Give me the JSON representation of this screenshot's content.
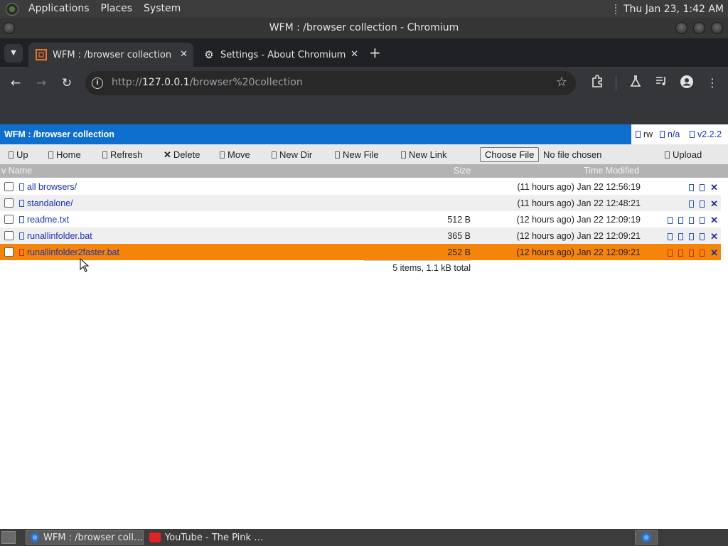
{
  "top_panel": {
    "menus": [
      "Applications",
      "Places",
      "System"
    ],
    "clock": "Thu Jan 23,  1:42 AM"
  },
  "window": {
    "title": "WFM : /browser collection - Chromium"
  },
  "tabs": [
    {
      "label": "WFM : /browser collection",
      "active": true
    },
    {
      "label": "Settings - About Chromium",
      "active": false
    }
  ],
  "toolbar": {
    "url_scheme": "http://",
    "url_host": "127.0.0.1",
    "url_path": "/browser%20collection"
  },
  "wfm": {
    "title": "WFM : /browser collection",
    "mode": "rw",
    "na": "n/a",
    "version": "v2.2.2",
    "actions": {
      "up": "Up",
      "home": "Home",
      "refresh": "Refresh",
      "delete": "Delete",
      "move": "Move",
      "new_dir": "New Dir",
      "new_file": "New File",
      "new_link": "New Link",
      "choose_file": "Choose File",
      "no_file": "No file chosen",
      "upload": "Upload"
    },
    "columns": {
      "name": "v Name",
      "size": "Size",
      "time": "Time Modified"
    },
    "files": [
      {
        "name": "all browsers/",
        "size": "",
        "time": "(11 hours ago) Jan 22 12:56:19",
        "ops": 2
      },
      {
        "name": "standalone/",
        "size": "",
        "time": "(11 hours ago) Jan 22 12:48:21",
        "ops": 2
      },
      {
        "name": "readme.txt",
        "size": "512 B",
        "time": "(12 hours ago) Jan 22 12:09:19",
        "ops": 4
      },
      {
        "name": "runallinfolder.bat",
        "size": "365 B",
        "time": "(12 hours ago) Jan 22 12:09:21",
        "ops": 4
      },
      {
        "name": "runallinfolder2faster.bat",
        "size": "252 B",
        "time": "(12 hours ago) Jan 22 12:09:21",
        "ops": 4,
        "selected": true
      }
    ],
    "summary": "5 items, 1.1 kB total",
    "colors": {
      "header_bg": "#0f6fcf",
      "selected_row": "#f5840b",
      "link": "#1a31b4"
    }
  },
  "taskbar": {
    "items": [
      {
        "label": "WFM : /browser coll…",
        "active": true
      },
      {
        "label": "YouTube - The Pink …",
        "active": false
      }
    ]
  }
}
